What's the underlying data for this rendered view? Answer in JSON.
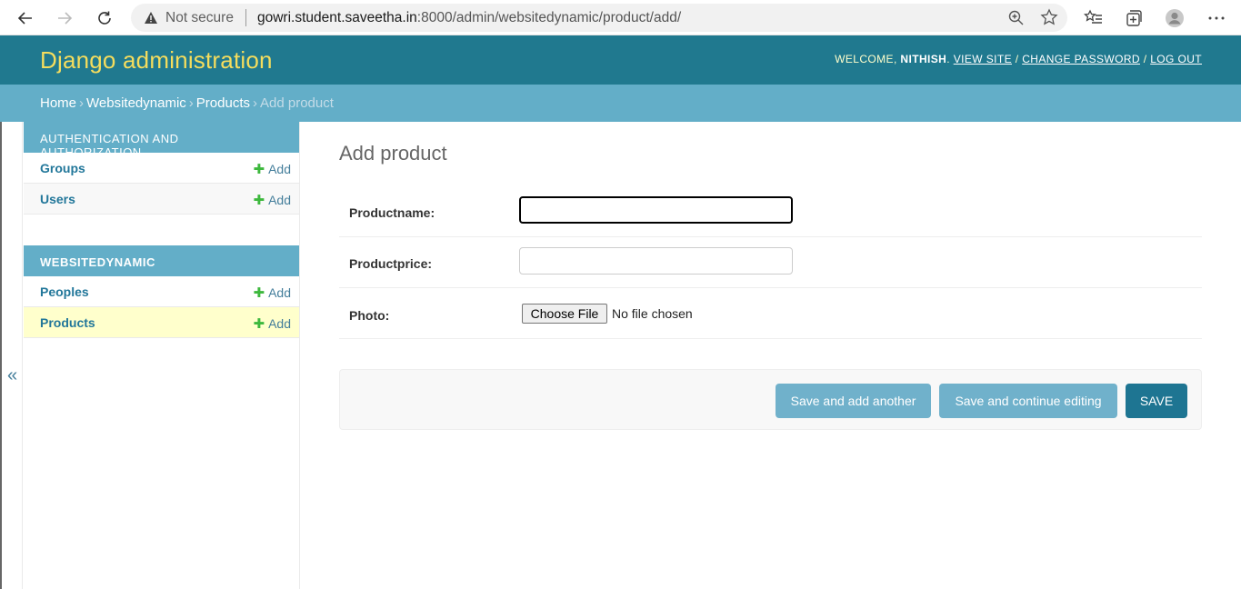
{
  "browser": {
    "security_label": "Not secure",
    "url_host": "gowri.student.saveetha.in",
    "url_rest": ":8000/admin/websitedynamic/product/add/"
  },
  "header": {
    "site_name": "Django administration",
    "welcome": "WELCOME,",
    "username": "NITHISH",
    "view_site": "VIEW SITE",
    "change_password": "CHANGE PASSWORD",
    "log_out": "LOG OUT"
  },
  "breadcrumbs": {
    "home": "Home",
    "app": "Websitedynamic",
    "model": "Products",
    "current": "Add product"
  },
  "sidebar": {
    "toggle_glyph": "«",
    "modules": [
      {
        "caption": "AUTHENTICATION AND AUTHORIZATION",
        "models": [
          {
            "name": "Groups",
            "add": "Add"
          },
          {
            "name": "Users",
            "add": "Add"
          }
        ]
      },
      {
        "caption": "WEBSITEDYNAMIC",
        "models": [
          {
            "name": "Peoples",
            "add": "Add"
          },
          {
            "name": "Products",
            "add": "Add"
          }
        ]
      }
    ]
  },
  "content": {
    "title": "Add product",
    "fields": {
      "productname_label": "Productname:",
      "productname_value": "",
      "productprice_label": "Productprice:",
      "productprice_value": "",
      "photo_label": "Photo:",
      "file_button": "Choose File",
      "file_status": "No file chosen"
    },
    "buttons": {
      "save_add_another": "Save and add another",
      "save_continue": "Save and continue editing",
      "save": "SAVE"
    }
  },
  "colors": {
    "header_bg": "#20798f",
    "breadcrumb_bg": "#63aec8",
    "site_name": "#f5dd5d",
    "current_row": "#ffffcc",
    "add_plus": "#3db83d"
  }
}
